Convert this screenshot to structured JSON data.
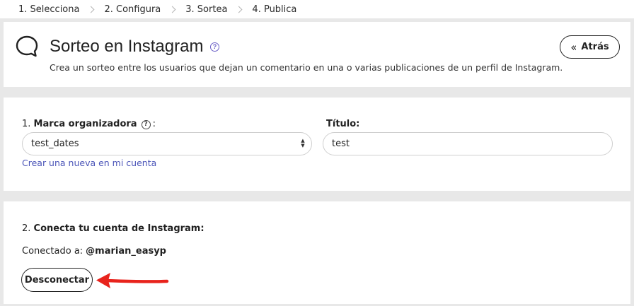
{
  "stepper": {
    "steps": [
      {
        "label": "1. Selecciona"
      },
      {
        "label": "2. Configura"
      },
      {
        "label": "3. Sortea"
      },
      {
        "label": "4. Publica"
      }
    ]
  },
  "header": {
    "icon": "chat-bubble-icon",
    "title": "Sorteo en Instagram",
    "help_icon": "question-circle-icon",
    "description": "Crea un sorteo entre los usuarios que dejan un comentario en una o varias publicaciones de un perfil de Instagram.",
    "back_button": {
      "icon": "double-chevron-left-icon",
      "label": "Atrás"
    }
  },
  "form": {
    "brand": {
      "prefix": "1.",
      "label": "Marca organizadora",
      "suffix": ":",
      "help_icon": "question-circle-icon",
      "selected": "test_dates"
    },
    "title": {
      "label": "Título:",
      "value": "test"
    },
    "create_link": "Crear una nueva en mi cuenta"
  },
  "connect": {
    "prefix": "2.",
    "label": "Conecta tu cuenta de Instagram:",
    "connected_text": "Conectado a:",
    "account": "@marian_easyp",
    "disconnect_label": "Desconectar"
  },
  "annotation": {
    "arrow_color": "#e8231c"
  },
  "colors": {
    "background": "#e8e8e8",
    "link": "#4b55b8",
    "help_accent": "#6a5fc6"
  }
}
